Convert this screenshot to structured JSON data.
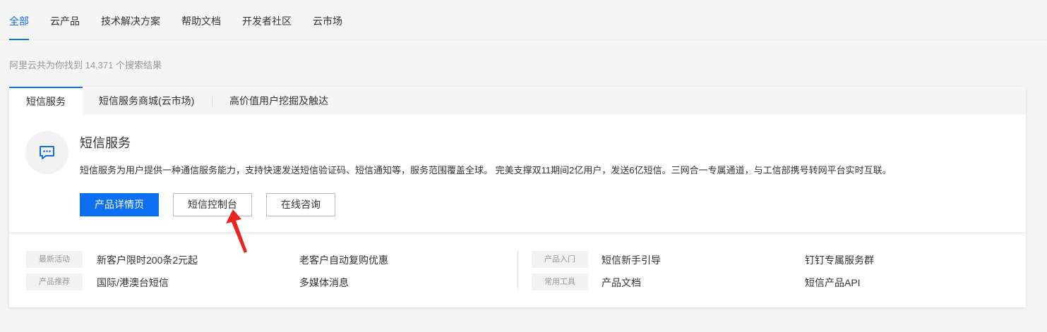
{
  "nav": {
    "tabs": [
      "全部",
      "云产品",
      "技术解决方案",
      "帮助文档",
      "开发者社区",
      "云市场"
    ],
    "active_color": "#0d6ff1"
  },
  "result_text": "阿里云共为你找到 14,371 个搜索结果",
  "card": {
    "tabs": [
      "短信服务",
      "短信服务商城(云市场)",
      "高价值用户挖掘及触达"
    ],
    "icon": "message-bubble-icon",
    "title": "短信服务",
    "description": "短信服务为用户提供一种通信服务能力，支持快速发送短信验证码、短信通知等，服务范围覆盖全球。 完美支撑双11期间2亿用户，发送6亿短信。三网合一专属通道，与工信部携号转网平台实时互联。",
    "buttons": {
      "detail": "产品详情页",
      "console": "短信控制台",
      "consult": "在线咨询"
    },
    "left_groups": [
      {
        "tag": "最新活动",
        "links": [
          "新客户限时200条2元起",
          "老客户自动复购优惠"
        ]
      },
      {
        "tag": "产品推荐",
        "links": [
          "国际/港澳台短信",
          "多媒体消息"
        ]
      }
    ],
    "right_groups": [
      {
        "tag": "产品入门",
        "links": [
          "短信新手引导",
          "钉钉专属服务群"
        ]
      },
      {
        "tag": "常用工具",
        "links": [
          "产品文档",
          "短信产品API"
        ]
      }
    ]
  },
  "annotation": {
    "icon": "red-arrow-icon",
    "color": "#e8251f"
  }
}
